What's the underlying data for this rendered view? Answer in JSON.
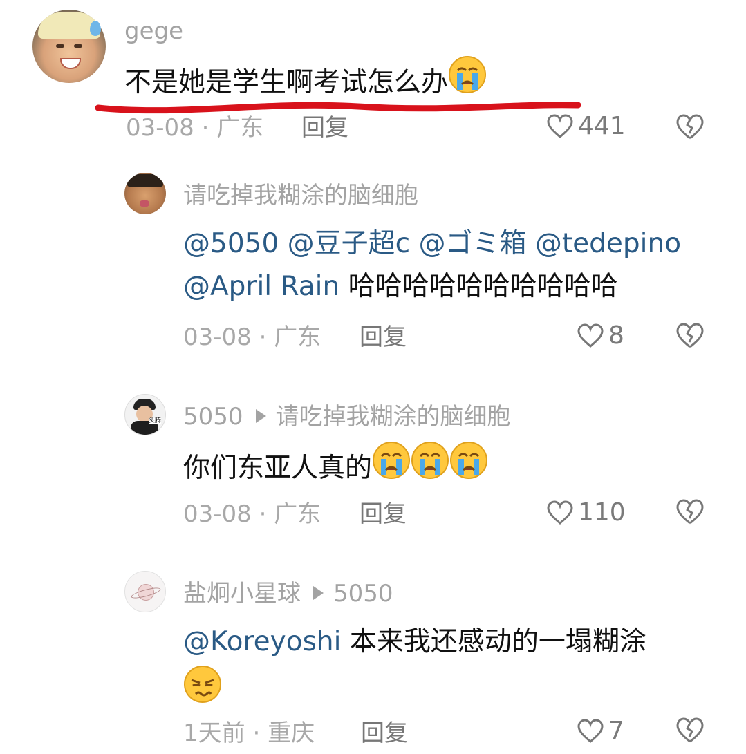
{
  "comments": [
    {
      "username": "gege",
      "text": "不是她是学生啊考试怎么办",
      "emoji": [
        "crying-face"
      ],
      "date": "03-08",
      "location": "广东",
      "reply_label": "回复",
      "likes": "441"
    },
    {
      "username": "请吃掉我糊涂的脑细胞",
      "mentions_line1": "@5050 @豆子超c @ゴミ箱 @tedepino",
      "mention_line2": "@April Rain",
      "text_line2": " 哈哈哈哈哈哈哈哈哈哈",
      "date": "03-08",
      "location": "广东",
      "reply_label": "回复",
      "likes": "8"
    },
    {
      "username": "5050",
      "reply_to": "请吃掉我糊涂的脑细胞",
      "text": "你们东亚人真的",
      "emoji": [
        "crying-face",
        "crying-face",
        "crying-face"
      ],
      "date": "03-08",
      "location": "广东",
      "reply_label": "回复",
      "likes": "110"
    },
    {
      "username": "盐炯小星球",
      "reply_to": "5050",
      "mention": "@Koreyoshi",
      "text": " 本来我还感动的一塌糊涂",
      "emoji": [
        "smirk-face"
      ],
      "date": "1天前",
      "location": "重庆",
      "reply_label": "回复",
      "likes": "7"
    }
  ],
  "avatar_badge": "头腾",
  "colors": {
    "underline": "#d8121b",
    "mention": "#2a5a85",
    "muted": "#a3a3a3"
  }
}
